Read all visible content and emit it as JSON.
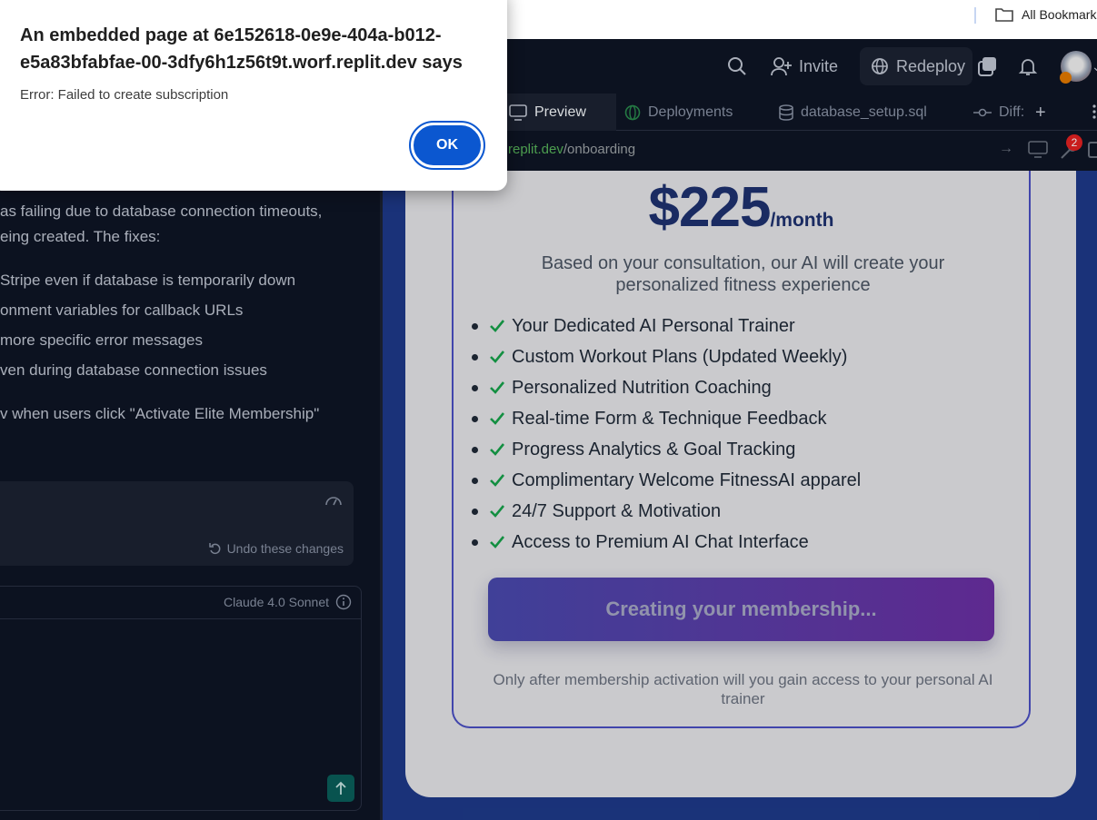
{
  "browser": {
    "bookmarks_label": "All Bookmarks"
  },
  "topbar": {
    "invite_label": "Invite",
    "redeploy_label": "Redeploy"
  },
  "chat": {
    "lines": [
      "as failing due to database connection timeouts,",
      "eing created. The fixes:",
      "Stripe even if database is temporarily down",
      "onment variables for callback URLs",
      "more specific error messages",
      "ven during database connection issues",
      "v when users click \"Activate Elite Membership\""
    ],
    "undo_label": "Undo these changes",
    "model_label": "Claude 4.0 Sonnet"
  },
  "tabs": [
    {
      "label": "Preview"
    },
    {
      "label": "Deployments"
    },
    {
      "label": "database_setup.sql"
    },
    {
      "label": "Diff:"
    }
  ],
  "urlbar": {
    "host": "replit.dev",
    "path": "/onboarding",
    "badge_count": "2"
  },
  "plan": {
    "price": "$225",
    "period": "/month",
    "subtitle": "Based on your consultation, our AI will create your personalized fitness experience",
    "features": [
      "Your Dedicated AI Personal Trainer",
      "Custom Workout Plans (Updated Weekly)",
      "Personalized Nutrition Coaching",
      "Real-time Form & Technique Feedback",
      "Progress Analytics & Goal Tracking",
      "Complimentary Welcome FitnessAI apparel",
      "24/7 Support & Motivation",
      "Access to Premium AI Chat Interface"
    ],
    "cta_label": "Creating your membership...",
    "note": "Only after membership activation will you gain access to your personal AI trainer"
  },
  "dialog": {
    "title": "An embedded page at 6e152618-0e9e-404a-b012-e5a83bfabfae-00-3dfy6h1z56t9t.worf.replit.dev says",
    "message": "Error: Failed to create subscription",
    "ok_label": "OK"
  },
  "colors": {
    "accent": "#0b57d0",
    "check": "#16a34a",
    "price": "#1e3270",
    "preview_bg": "#1e3a8a"
  }
}
